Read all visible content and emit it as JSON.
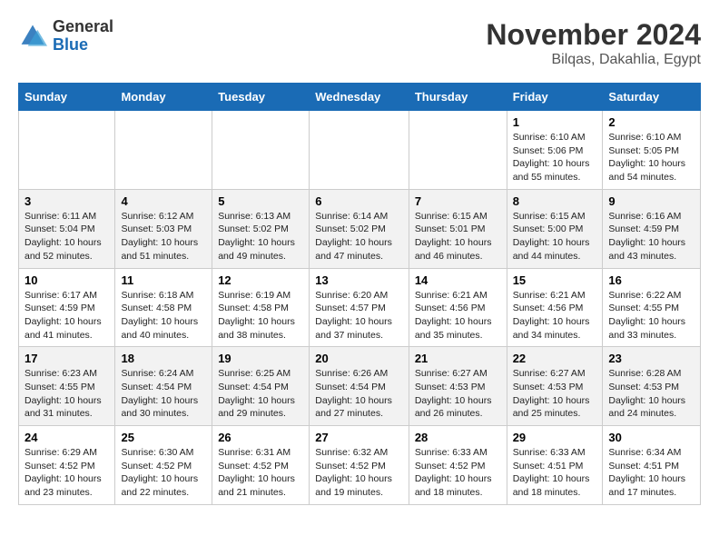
{
  "header": {
    "logo_general": "General",
    "logo_blue": "Blue",
    "month_title": "November 2024",
    "location": "Bilqas, Dakahlia, Egypt"
  },
  "columns": [
    "Sunday",
    "Monday",
    "Tuesday",
    "Wednesday",
    "Thursday",
    "Friday",
    "Saturday"
  ],
  "rows": [
    [
      {
        "day": "",
        "info": ""
      },
      {
        "day": "",
        "info": ""
      },
      {
        "day": "",
        "info": ""
      },
      {
        "day": "",
        "info": ""
      },
      {
        "day": "",
        "info": ""
      },
      {
        "day": "1",
        "info": "Sunrise: 6:10 AM\nSunset: 5:06 PM\nDaylight: 10 hours\nand 55 minutes."
      },
      {
        "day": "2",
        "info": "Sunrise: 6:10 AM\nSunset: 5:05 PM\nDaylight: 10 hours\nand 54 minutes."
      }
    ],
    [
      {
        "day": "3",
        "info": "Sunrise: 6:11 AM\nSunset: 5:04 PM\nDaylight: 10 hours\nand 52 minutes."
      },
      {
        "day": "4",
        "info": "Sunrise: 6:12 AM\nSunset: 5:03 PM\nDaylight: 10 hours\nand 51 minutes."
      },
      {
        "day": "5",
        "info": "Sunrise: 6:13 AM\nSunset: 5:02 PM\nDaylight: 10 hours\nand 49 minutes."
      },
      {
        "day": "6",
        "info": "Sunrise: 6:14 AM\nSunset: 5:02 PM\nDaylight: 10 hours\nand 47 minutes."
      },
      {
        "day": "7",
        "info": "Sunrise: 6:15 AM\nSunset: 5:01 PM\nDaylight: 10 hours\nand 46 minutes."
      },
      {
        "day": "8",
        "info": "Sunrise: 6:15 AM\nSunset: 5:00 PM\nDaylight: 10 hours\nand 44 minutes."
      },
      {
        "day": "9",
        "info": "Sunrise: 6:16 AM\nSunset: 4:59 PM\nDaylight: 10 hours\nand 43 minutes."
      }
    ],
    [
      {
        "day": "10",
        "info": "Sunrise: 6:17 AM\nSunset: 4:59 PM\nDaylight: 10 hours\nand 41 minutes."
      },
      {
        "day": "11",
        "info": "Sunrise: 6:18 AM\nSunset: 4:58 PM\nDaylight: 10 hours\nand 40 minutes."
      },
      {
        "day": "12",
        "info": "Sunrise: 6:19 AM\nSunset: 4:58 PM\nDaylight: 10 hours\nand 38 minutes."
      },
      {
        "day": "13",
        "info": "Sunrise: 6:20 AM\nSunset: 4:57 PM\nDaylight: 10 hours\nand 37 minutes."
      },
      {
        "day": "14",
        "info": "Sunrise: 6:21 AM\nSunset: 4:56 PM\nDaylight: 10 hours\nand 35 minutes."
      },
      {
        "day": "15",
        "info": "Sunrise: 6:21 AM\nSunset: 4:56 PM\nDaylight: 10 hours\nand 34 minutes."
      },
      {
        "day": "16",
        "info": "Sunrise: 6:22 AM\nSunset: 4:55 PM\nDaylight: 10 hours\nand 33 minutes."
      }
    ],
    [
      {
        "day": "17",
        "info": "Sunrise: 6:23 AM\nSunset: 4:55 PM\nDaylight: 10 hours\nand 31 minutes."
      },
      {
        "day": "18",
        "info": "Sunrise: 6:24 AM\nSunset: 4:54 PM\nDaylight: 10 hours\nand 30 minutes."
      },
      {
        "day": "19",
        "info": "Sunrise: 6:25 AM\nSunset: 4:54 PM\nDaylight: 10 hours\nand 29 minutes."
      },
      {
        "day": "20",
        "info": "Sunrise: 6:26 AM\nSunset: 4:54 PM\nDaylight: 10 hours\nand 27 minutes."
      },
      {
        "day": "21",
        "info": "Sunrise: 6:27 AM\nSunset: 4:53 PM\nDaylight: 10 hours\nand 26 minutes."
      },
      {
        "day": "22",
        "info": "Sunrise: 6:27 AM\nSunset: 4:53 PM\nDaylight: 10 hours\nand 25 minutes."
      },
      {
        "day": "23",
        "info": "Sunrise: 6:28 AM\nSunset: 4:53 PM\nDaylight: 10 hours\nand 24 minutes."
      }
    ],
    [
      {
        "day": "24",
        "info": "Sunrise: 6:29 AM\nSunset: 4:52 PM\nDaylight: 10 hours\nand 23 minutes."
      },
      {
        "day": "25",
        "info": "Sunrise: 6:30 AM\nSunset: 4:52 PM\nDaylight: 10 hours\nand 22 minutes."
      },
      {
        "day": "26",
        "info": "Sunrise: 6:31 AM\nSunset: 4:52 PM\nDaylight: 10 hours\nand 21 minutes."
      },
      {
        "day": "27",
        "info": "Sunrise: 6:32 AM\nSunset: 4:52 PM\nDaylight: 10 hours\nand 19 minutes."
      },
      {
        "day": "28",
        "info": "Sunrise: 6:33 AM\nSunset: 4:52 PM\nDaylight: 10 hours\nand 18 minutes."
      },
      {
        "day": "29",
        "info": "Sunrise: 6:33 AM\nSunset: 4:51 PM\nDaylight: 10 hours\nand 18 minutes."
      },
      {
        "day": "30",
        "info": "Sunrise: 6:34 AM\nSunset: 4:51 PM\nDaylight: 10 hours\nand 17 minutes."
      }
    ]
  ]
}
